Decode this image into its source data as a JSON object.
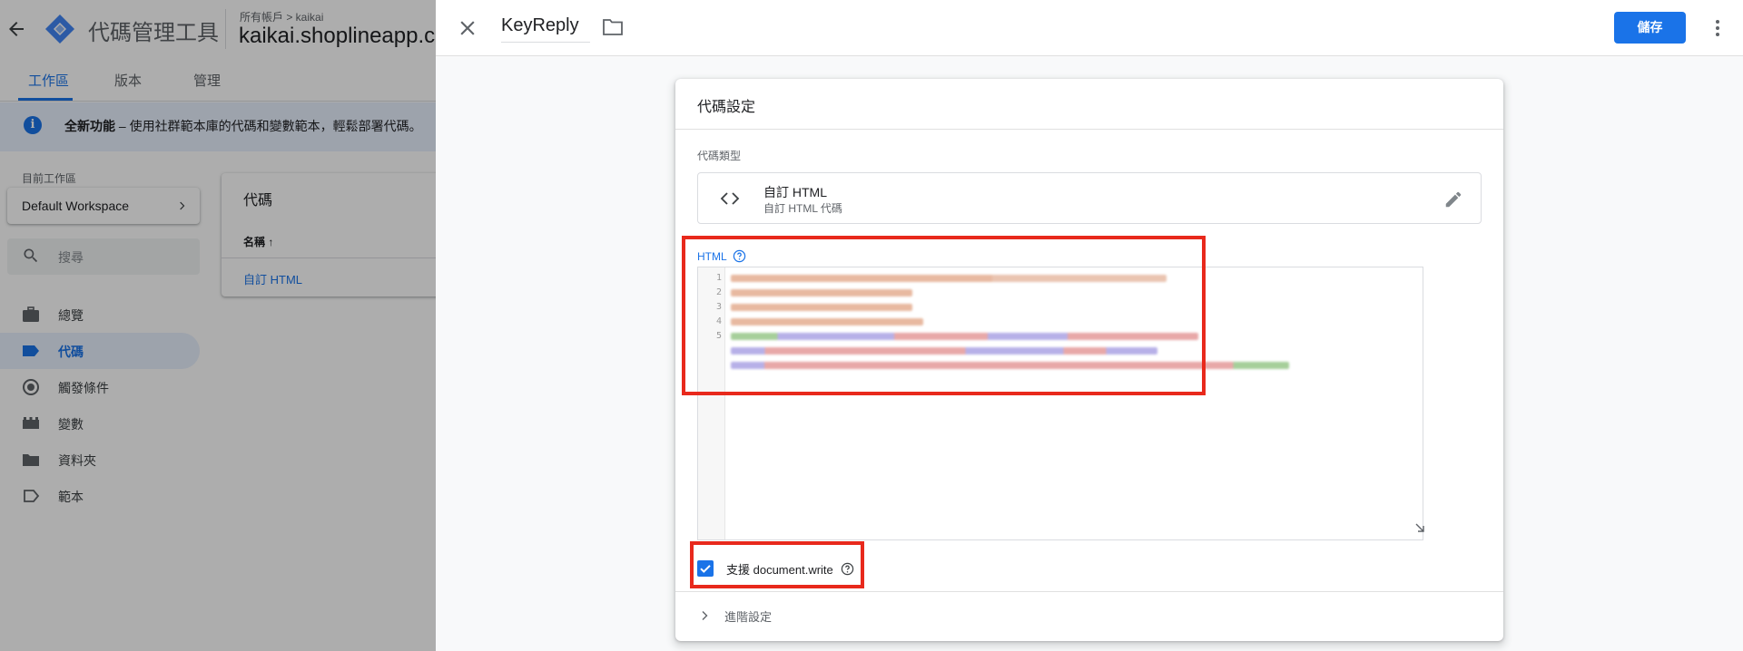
{
  "bg": {
    "app_name": "代碼管理工具",
    "breadcrumb": "所有帳戶 > kaikai",
    "container_name": "kaikai.shoplineapp.co",
    "tabs": [
      "工作區",
      "版本",
      "管理"
    ],
    "banner": {
      "title": "全新功能",
      "text": " – 使用社群範本庫的代碼和變數範本，輕鬆部署代碼。"
    },
    "workspace_label": "目前工作區",
    "workspace_name": "Default Workspace",
    "search_placeholder": "搜尋",
    "nav": [
      {
        "label": "總覽",
        "icon": "briefcase-icon"
      },
      {
        "label": "代碼",
        "icon": "tag-icon",
        "active": true
      },
      {
        "label": "觸發條件",
        "icon": "trigger-icon"
      },
      {
        "label": "變數",
        "icon": "variables-icon"
      },
      {
        "label": "資料夾",
        "icon": "folder-icon"
      },
      {
        "label": "範本",
        "icon": "template-tag-icon"
      }
    ],
    "tags_card": {
      "title": "代碼",
      "column": "名稱 ↑",
      "row": "自訂 HTML"
    }
  },
  "panel": {
    "tag_name": "KeyReply",
    "save_label": "儲存",
    "card_title": "代碼設定",
    "type_label": "代碼類型",
    "type_name": "自訂 HTML",
    "type_desc": "自訂 HTML 代碼",
    "html_label": "HTML",
    "line_numbers": [
      "1",
      "2",
      "3",
      "4",
      "5"
    ],
    "docwrite_label": "支援 document.write",
    "docwrite_checked": true,
    "advanced_label": "進階設定"
  },
  "colors": {
    "accent": "#1a73e8",
    "highlight": "#e8291c"
  }
}
